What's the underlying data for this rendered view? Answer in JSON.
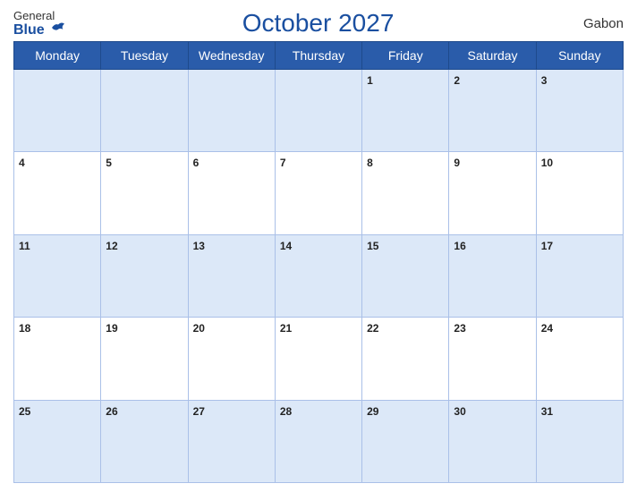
{
  "header": {
    "logo_general": "General",
    "logo_blue": "Blue",
    "title": "October 2027",
    "country": "Gabon"
  },
  "days_of_week": [
    "Monday",
    "Tuesday",
    "Wednesday",
    "Thursday",
    "Friday",
    "Saturday",
    "Sunday"
  ],
  "weeks": [
    [
      null,
      null,
      null,
      null,
      1,
      2,
      3
    ],
    [
      4,
      5,
      6,
      7,
      8,
      9,
      10
    ],
    [
      11,
      12,
      13,
      14,
      15,
      16,
      17
    ],
    [
      18,
      19,
      20,
      21,
      22,
      23,
      24
    ],
    [
      25,
      26,
      27,
      28,
      29,
      30,
      31
    ]
  ]
}
